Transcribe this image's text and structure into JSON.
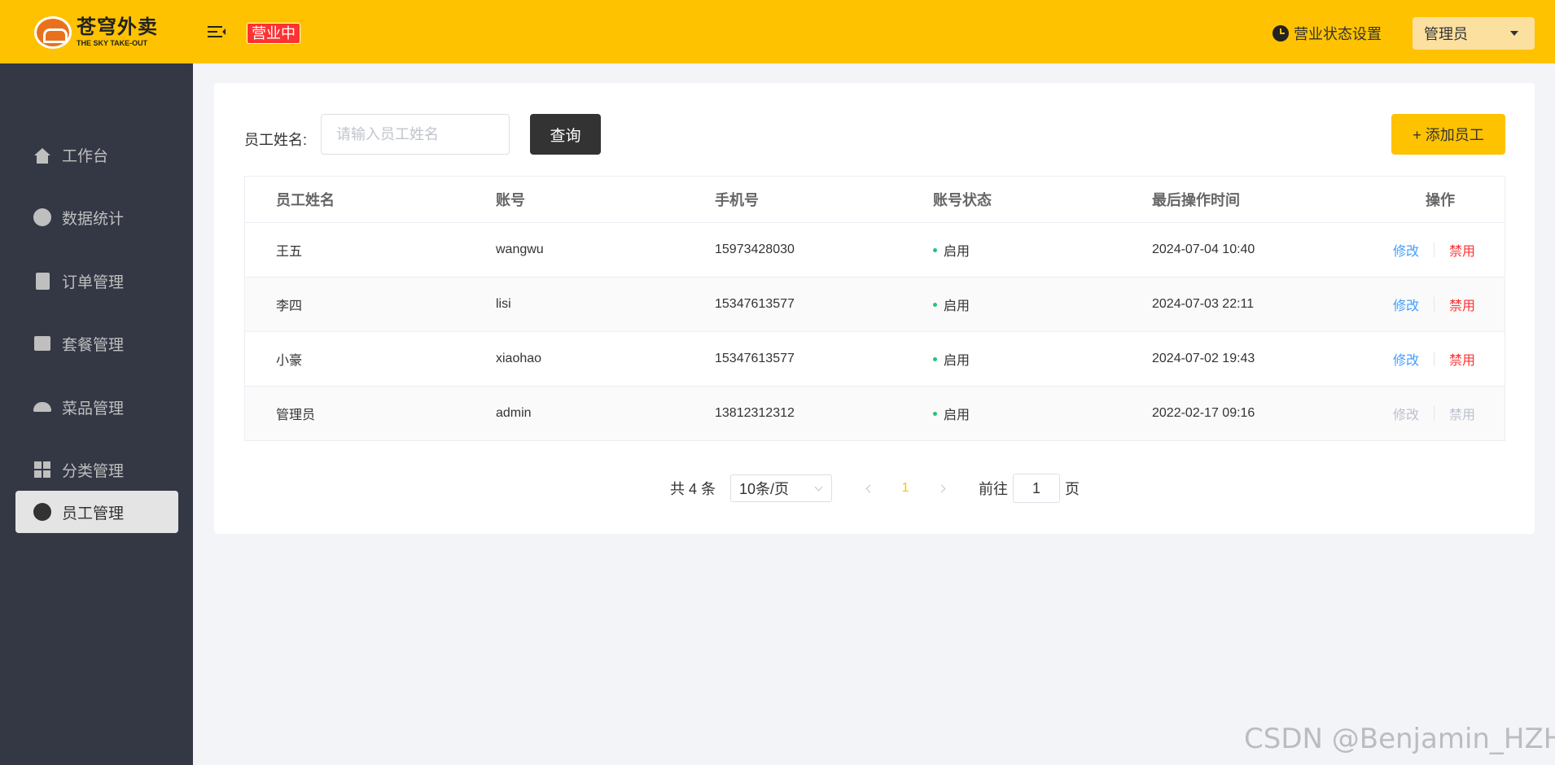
{
  "header": {
    "logo_cn": "苍穹外卖",
    "logo_en": "THE SKY TAKE-OUT",
    "status_badge": "营业中",
    "biz_setting": "营业状态设置",
    "user_dropdown": "管理员",
    "colors": {
      "brand": "#ffc200",
      "badge": "#fd3333"
    }
  },
  "sidebar": {
    "items": [
      {
        "label": "工作台",
        "icon": "home-icon"
      },
      {
        "label": "数据统计",
        "icon": "stats-icon"
      },
      {
        "label": "订单管理",
        "icon": "order-icon"
      },
      {
        "label": "套餐管理",
        "icon": "gift-icon"
      },
      {
        "label": "菜品管理",
        "icon": "dish-icon"
      },
      {
        "label": "分类管理",
        "icon": "category-icon"
      },
      {
        "label": "员工管理",
        "icon": "employee-icon",
        "active": true
      }
    ]
  },
  "search": {
    "label": "员工姓名:",
    "placeholder": "请输入员工姓名",
    "value": "",
    "query_button": "查询",
    "add_button": "+ 添加员工"
  },
  "table": {
    "columns": [
      "员工姓名",
      "账号",
      "手机号",
      "账号状态",
      "最后操作时间",
      "操作"
    ],
    "rows": [
      {
        "name": "王五",
        "account": "wangwu",
        "phone": "15973428030",
        "status": "启用",
        "time": "2024-07-04 10:40",
        "edit": "修改",
        "ban": "禁用"
      },
      {
        "name": "李四",
        "account": "lisi",
        "phone": "15347613577",
        "status": "启用",
        "time": "2024-07-03 22:11",
        "edit": "修改",
        "ban": "禁用"
      },
      {
        "name": "小豪",
        "account": "xiaohao",
        "phone": "15347613577",
        "status": "启用",
        "time": "2024-07-02 19:43",
        "edit": "修改",
        "ban": "禁用"
      },
      {
        "name": "管理员",
        "account": "admin",
        "phone": "13812312312",
        "status": "启用",
        "time": "2022-02-17 09:16",
        "edit": "修改",
        "ban": "禁用",
        "disabled": true
      }
    ]
  },
  "pagination": {
    "total": "共 4 条",
    "page_size": "10条/页",
    "current_page": "1",
    "goto_label": "前往",
    "goto_value": "1",
    "goto_suffix": "页"
  },
  "watermark": "CSDN @Benjamin_HZH"
}
